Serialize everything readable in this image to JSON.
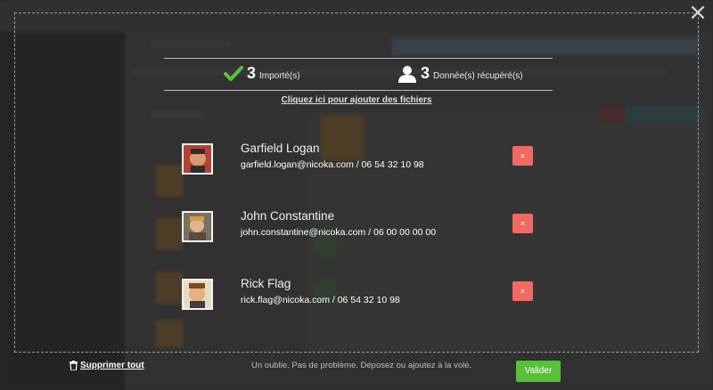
{
  "stats": {
    "imported": {
      "count": "3",
      "label": "Importé(s)",
      "icon": "check-icon",
      "color": "#5bbf3e"
    },
    "retrieved": {
      "count": "3",
      "label": "Donnée(s) récupéré(s)",
      "icon": "user-icon"
    }
  },
  "add_files_link": "Cliquez ici pour ajouter des fichiers",
  "contacts": [
    {
      "name": "Garfield Logan",
      "info": "garfield.logan@nicoka.com / 06 54 32 10 98",
      "remove_label": "×"
    },
    {
      "name": "John Constantine",
      "info": "john.constantine@nicoka.com / 06 00 00 00 00",
      "remove_label": "×"
    },
    {
      "name": "Rick Flag",
      "info": "rick.flag@nicoka.com / 06 54 32 10 98",
      "remove_label": "×"
    }
  ],
  "footer": {
    "delete_all": "Supprimer tout",
    "message": "Un oublie. Pas de problème. Déposez ou ajoutez à la volé.",
    "validate": "Valider"
  },
  "colors": {
    "remove": "#ef6a63",
    "validate": "#5bbf3e"
  }
}
